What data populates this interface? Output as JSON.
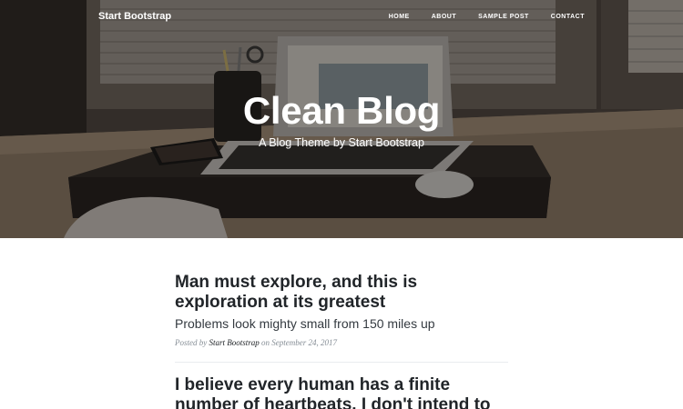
{
  "navbar": {
    "brand": "Start Bootstrap",
    "links": [
      "Home",
      "About",
      "Sample Post",
      "Contact"
    ]
  },
  "hero": {
    "title": "Clean Blog",
    "subtitle": "A Blog Theme by Start Bootstrap"
  },
  "posts": [
    {
      "title": "Man must explore, and this is exploration at its greatest",
      "subtitle": "Problems look mighty small from 150 miles up",
      "meta_prefix": "Posted by",
      "author": "Start Bootstrap",
      "meta_on": "on September 24, 2017"
    },
    {
      "title": "I believe every human has a finite number of heartbeats. I don't intend to"
    }
  ],
  "colors": {
    "title_text": "#212529",
    "meta_text": "#868e96",
    "divider": "#e9ecef"
  }
}
